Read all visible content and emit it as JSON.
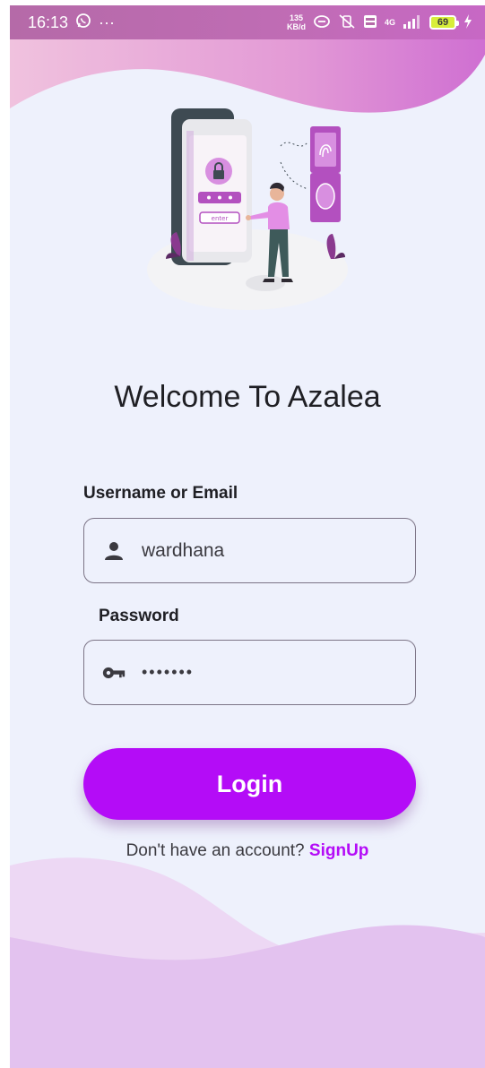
{
  "status_bar": {
    "time": "16:13",
    "whatsapp_icon": "whatsapp-icon",
    "more": "···",
    "speed_value": "135",
    "speed_unit": "KB/d",
    "network": "4G",
    "battery": "69"
  },
  "header": {
    "title": "Welcome To Azalea"
  },
  "form": {
    "username_label": "Username or Email",
    "username_value": "wardhana",
    "password_label": "Password",
    "password_value": "•••••••",
    "login_label": "Login"
  },
  "signup": {
    "prompt": "Don't have an account? ",
    "link": "SignUp"
  },
  "colors": {
    "accent": "#b40cf7",
    "background": "#eef1fc",
    "wave_top": "#d986d2",
    "wave_bottom": "#e8c9ef"
  },
  "icons": {
    "user": "person-icon",
    "password": "key-icon"
  }
}
